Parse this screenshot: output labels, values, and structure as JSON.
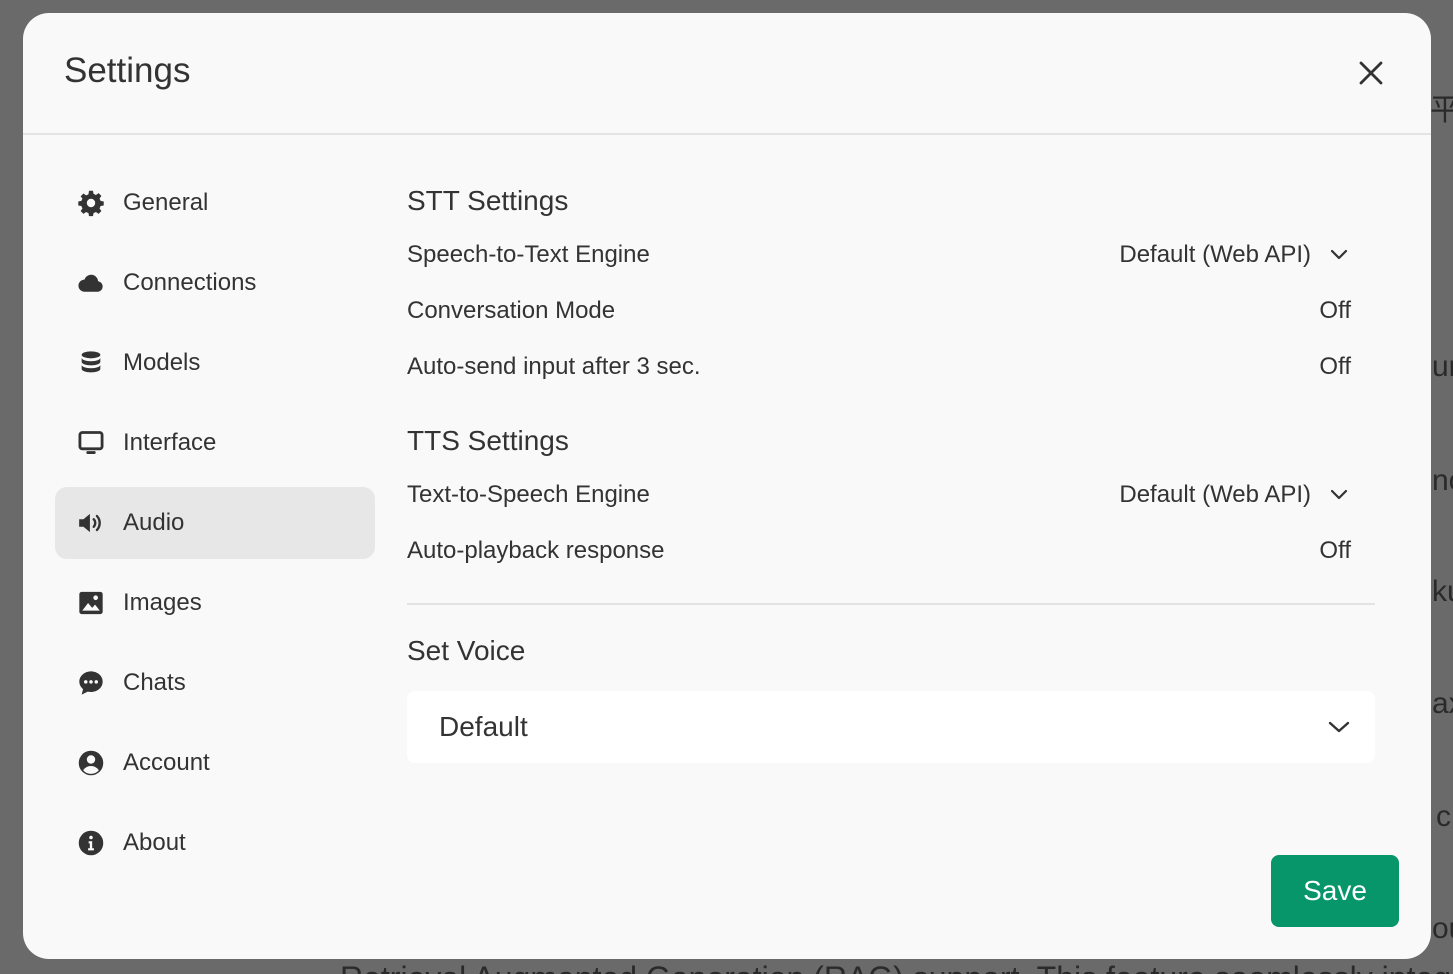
{
  "background": {
    "fragments": [
      "平",
      "ur",
      "no",
      "ku",
      "ax",
      "c",
      "ou"
    ],
    "bottom_text": "Retrieval Augmented Generation (RAG) support. This feature seamlessly integrates"
  },
  "modal": {
    "title": "Settings"
  },
  "sidebar": {
    "items": [
      {
        "label": "General",
        "icon": "gear-icon"
      },
      {
        "label": "Connections",
        "icon": "cloud-icon"
      },
      {
        "label": "Models",
        "icon": "database-icon"
      },
      {
        "label": "Interface",
        "icon": "monitor-icon"
      },
      {
        "label": "Audio",
        "icon": "speaker-icon",
        "active": true
      },
      {
        "label": "Images",
        "icon": "image-icon"
      },
      {
        "label": "Chats",
        "icon": "chat-bubble-icon"
      },
      {
        "label": "Account",
        "icon": "user-circle-icon"
      },
      {
        "label": "About",
        "icon": "info-icon"
      }
    ]
  },
  "audio": {
    "stt": {
      "title": "STT Settings",
      "engine_label": "Speech-to-Text Engine",
      "engine_value": "Default (Web API)",
      "conversation_label": "Conversation Mode",
      "conversation_value": "Off",
      "autosend_label": "Auto-send input after 3 sec.",
      "autosend_value": "Off"
    },
    "tts": {
      "title": "TTS Settings",
      "engine_label": "Text-to-Speech Engine",
      "engine_value": "Default (Web API)",
      "autoplay_label": "Auto-playback response",
      "autoplay_value": "Off"
    },
    "voice": {
      "title": "Set Voice",
      "value": "Default"
    }
  },
  "actions": {
    "save_label": "Save"
  },
  "colors": {
    "accent": "#079669",
    "modal_bg": "#f9f9f9",
    "overlay": "#6a6a6a",
    "active_item": "#e7e7e7",
    "text": "#333333"
  }
}
